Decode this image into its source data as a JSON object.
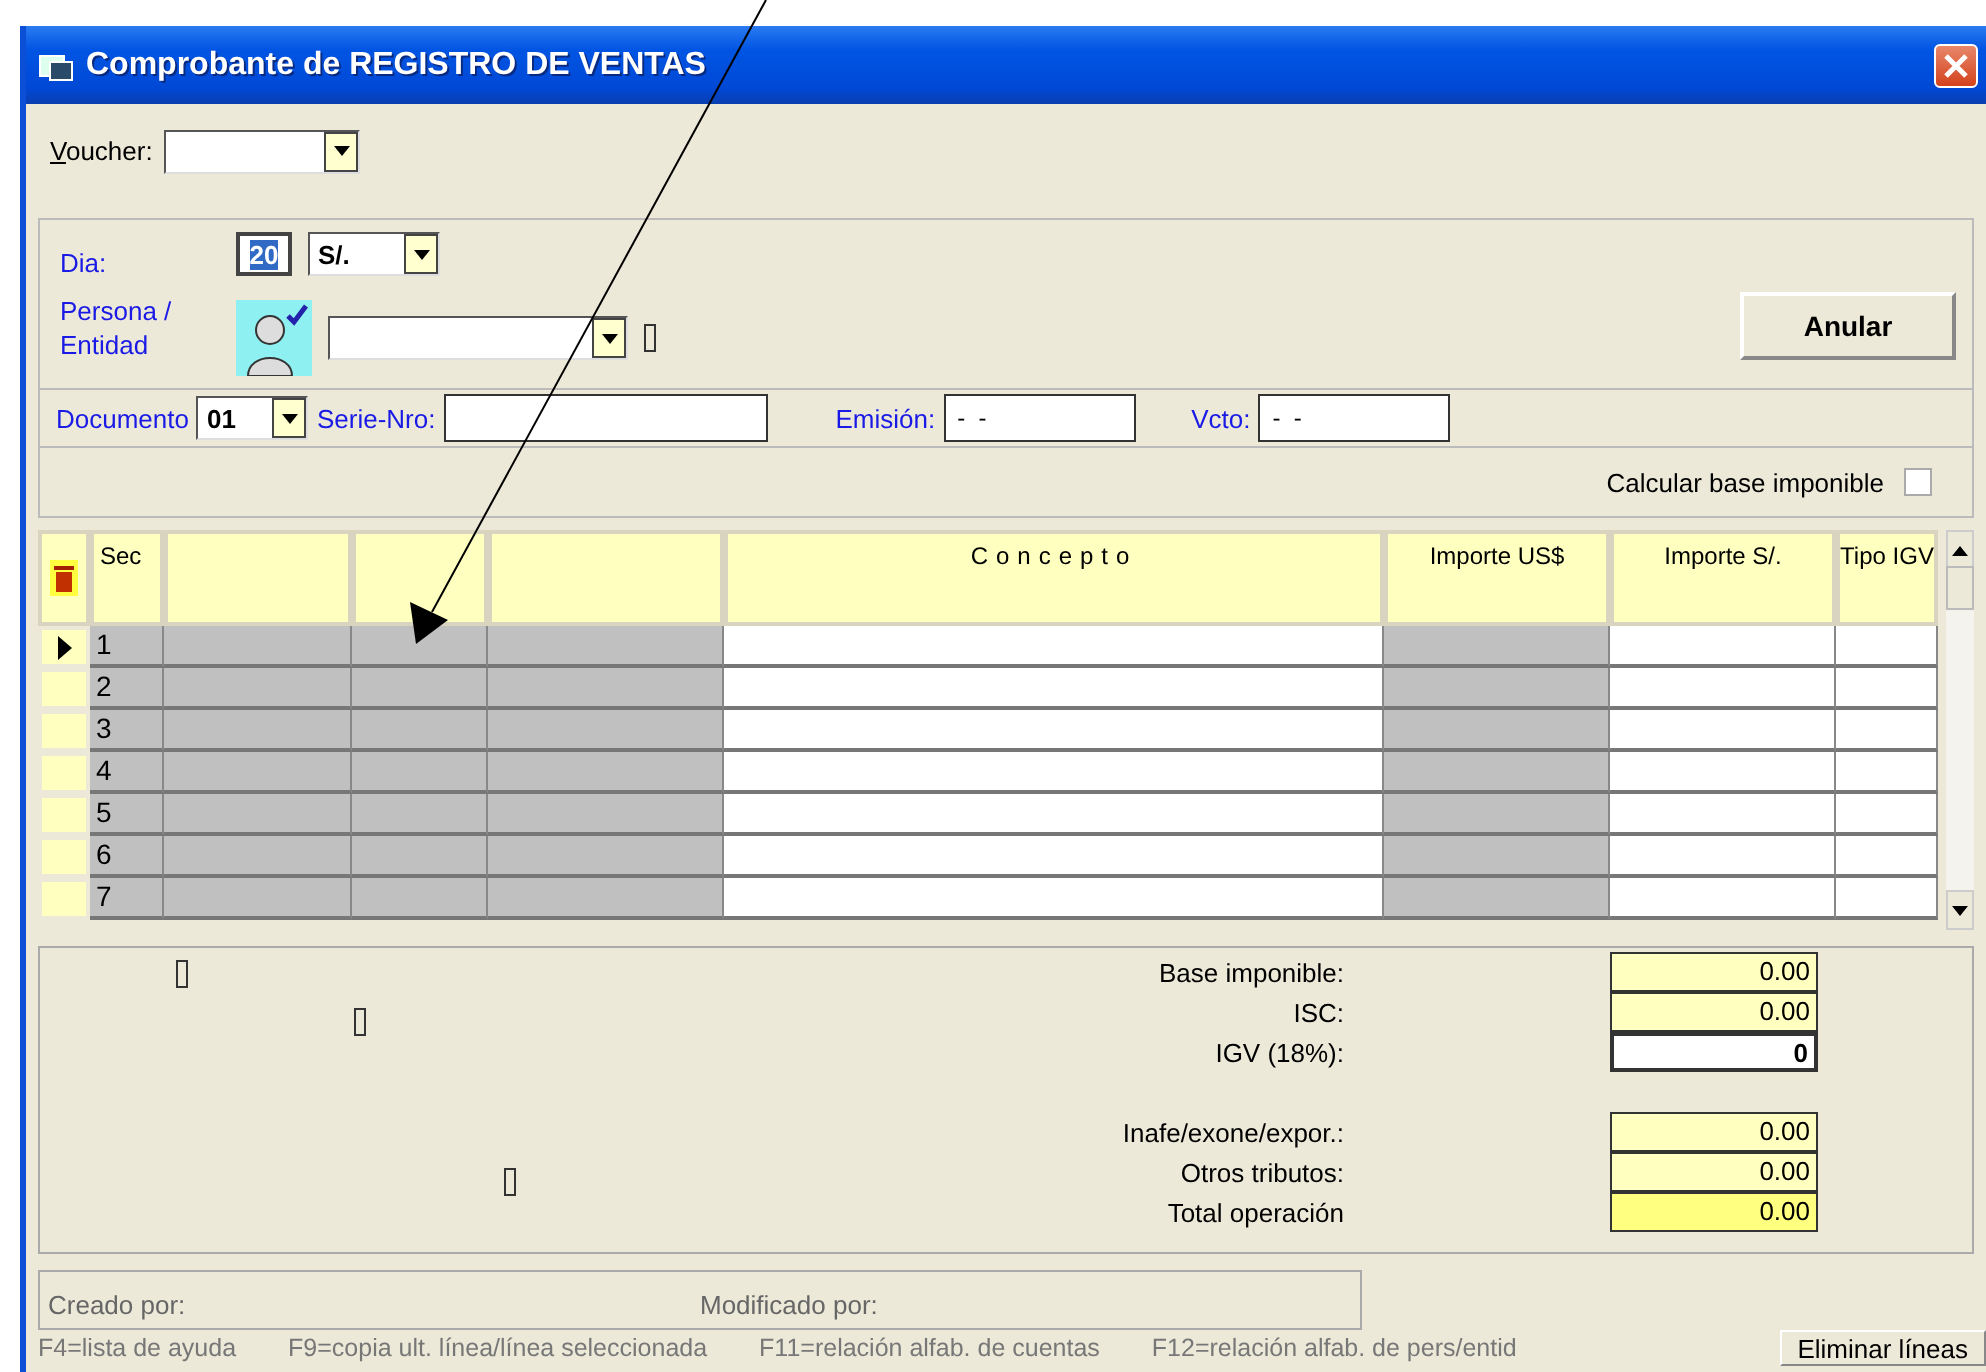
{
  "window": {
    "title": "Comprobante de REGISTRO DE VENTAS"
  },
  "voucher": {
    "label": "Voucher:"
  },
  "dia": {
    "label": "Dia:",
    "value": "20",
    "text_selected": true
  },
  "currency": {
    "value": "S/."
  },
  "persona": {
    "label": "Persona / Entidad"
  },
  "anular_button": "Anular",
  "documento": {
    "label": "Documento",
    "value": "01"
  },
  "serie": {
    "label": "Serie-Nro:"
  },
  "emision": {
    "label": "Emisión:",
    "value": "-  -"
  },
  "vcto": {
    "label": "Vcto:",
    "value": "-  -"
  },
  "calcular": {
    "label": "Calcular base imponible",
    "checked": false
  },
  "table": {
    "columns": [
      {
        "kind": "marker"
      },
      {
        "kind": "text",
        "label": "Sec",
        "disabled": true
      },
      {
        "kind": "text",
        "disabled": true
      },
      {
        "kind": "text",
        "disabled": true
      },
      {
        "kind": "text",
        "disabled": true
      },
      {
        "kind": "text",
        "label": "Concepto",
        "disabled": false
      },
      {
        "kind": "text",
        "label": "Importe US$",
        "disabled": true
      },
      {
        "kind": "text",
        "label": "Importe S/.",
        "disabled": false
      },
      {
        "kind": "text",
        "label": "Tipo IGV",
        "disabled": false
      }
    ],
    "rows": [
      {
        "sec": "1",
        "current": true
      },
      {
        "sec": "2",
        "current": false
      },
      {
        "sec": "3",
        "current": false
      },
      {
        "sec": "4",
        "current": false
      },
      {
        "sec": "5",
        "current": false
      },
      {
        "sec": "6",
        "current": false
      },
      {
        "sec": "7",
        "current": false
      }
    ]
  },
  "totals": [
    {
      "label": "Base imponible:",
      "value": "0.00",
      "kind": "computed"
    },
    {
      "label": "ISC:",
      "value": "0.00",
      "kind": "computed"
    },
    {
      "label": "IGV (18%):",
      "value": "0",
      "kind": "input"
    },
    {
      "kind": "gap"
    },
    {
      "label": "Inafe/exone/expor.:",
      "value": "0.00",
      "kind": "computed"
    },
    {
      "label": "Otros tributos:",
      "value": "0.00",
      "kind": "computed"
    },
    {
      "label": "Total operación",
      "value": "0.00",
      "kind": "total"
    }
  ],
  "audit": {
    "created_label": "Creado por:",
    "modified_label": "Modificado por:"
  },
  "status_bar": {
    "hints": [
      "F4=lista de ayuda",
      "F9=copia ult. línea/línea seleccionada",
      "F11=relación alfab. de cuentas",
      "F12=relación alfab. de pers/entid"
    ],
    "button": "Eliminar líneas"
  }
}
